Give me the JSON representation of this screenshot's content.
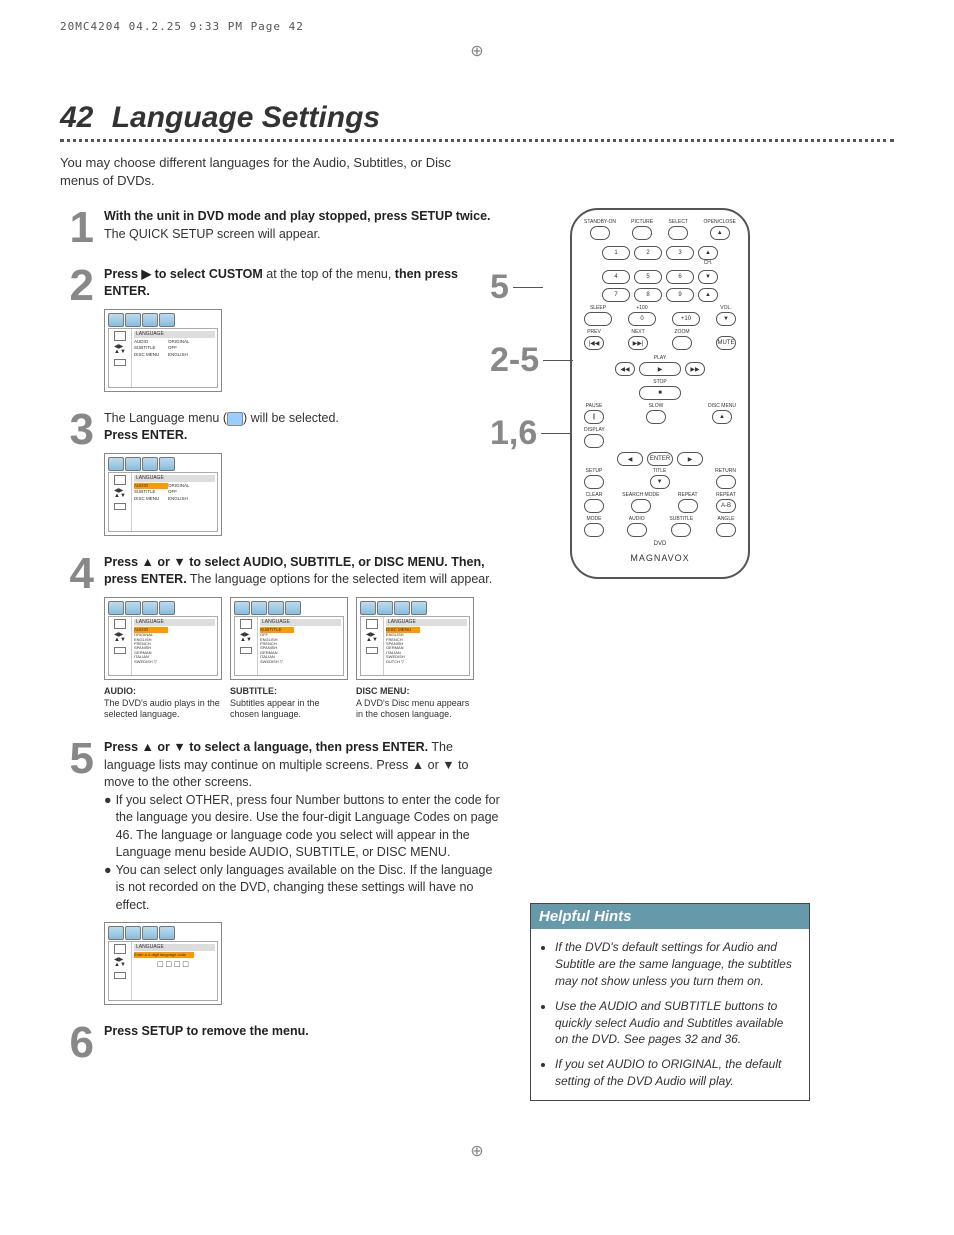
{
  "print_header": "20MC4204  04.2.25  9:33 PM  Page 42",
  "page_number": "42",
  "title": "Language Settings",
  "intro": "You may choose different languages for the Audio, Subtitles, or Disc menus of DVDs.",
  "steps": {
    "s1": {
      "num": "1",
      "bold": "With the unit in DVD mode and play stopped, press SETUP twice.",
      "rest": " The QUICK SETUP screen will appear."
    },
    "s2": {
      "num": "2",
      "bold_a": "Press ",
      "bold_b": " to select CUSTOM",
      "rest": " at the top of the menu, ",
      "bold_c": "then press ENTER."
    },
    "s3": {
      "num": "3",
      "lead": "The Language menu (",
      "lead_end": ") will be selected.",
      "bold": "Press ENTER."
    },
    "s4": {
      "num": "4",
      "bold": "Press ▲ or ▼ to select AUDIO, SUBTITLE, or DISC MENU. Then, press ENTER.",
      "rest": " The language options for the selected item will appear."
    },
    "s5": {
      "num": "5",
      "bold": "Press ▲ or ▼ to select a language, then press ENTER.",
      "rest": " The language lists may continue on multiple screens. Press ▲ or ▼ to move to the other screens.",
      "b1": "If you select OTHER, press four Number buttons to enter the code for the language you desire. Use the four-digit Language Codes on page 46. The language or language code you select will appear in the Language menu beside AUDIO, SUBTITLE, or DISC MENU.",
      "b2": "You can select only languages available on the Disc. If the language is not recorded on the DVD, changing these settings will have no effect."
    },
    "s6": {
      "num": "6",
      "bold": "Press SETUP to remove the menu."
    }
  },
  "menus": {
    "lang_header": "LANGUAGE",
    "rows": {
      "audio": "AUDIO",
      "subtitle": "SUBTITLE",
      "disc_menu": "DISC MENU",
      "original": "ORIGINAL",
      "off": "OFF",
      "english": "ENGLISH"
    },
    "lang_list": [
      "ENGLISH",
      "FRENCH",
      "SPANISH",
      "GERMAN",
      "ITALIAN",
      "SWEDISH"
    ],
    "lang_list_dm": [
      "ENGLISH",
      "FRENCH",
      "SPANISH",
      "GERMAN",
      "ITALIAN",
      "SWEDISH",
      "DUTCH"
    ],
    "other_code": "Enter a 4-digit language code",
    "digits": "□□□□"
  },
  "captions": {
    "audio": {
      "title": "AUDIO:",
      "body": "The DVD's audio plays in the selected language."
    },
    "subtitle": {
      "title": "SUBTITLE:",
      "body": "Subtitles appear in the chosen language."
    },
    "discmenu": {
      "title": "DISC MENU:",
      "body": "A DVD's Disc menu appears in the chosen language."
    }
  },
  "callouts": {
    "c1": "5",
    "c2": "2-5",
    "c3": "1,6"
  },
  "remote_brand": "MAGNAVOX",
  "hints": {
    "title": "Helpful Hints",
    "items": [
      "If the DVD's default settings for Audio and Subtitle are the same language, the subtitles may not show unless you turn them on.",
      "Use the AUDIO and SUBTITLE buttons to quickly select Audio and Subtitles available on the DVD. See pages 32 and 36.",
      "If you set AUDIO to ORIGINAL, the default setting of the DVD Audio will play."
    ]
  },
  "remote": {
    "row1": [
      "STANDBY-ON",
      "PICTURE",
      "SELECT",
      "OPEN/CLOSE"
    ],
    "eject": "▲",
    "nums": [
      "1",
      "2",
      "3",
      "4",
      "5",
      "6",
      "7",
      "8",
      "9",
      "0"
    ],
    "ch": "CH.",
    "sleep": "SLEEP",
    "plus100": "+100",
    "plus10": "+10",
    "vol": "VOL.",
    "prev": "PREV",
    "next": "NEXT",
    "zoom": "ZOOM",
    "prev_sym": "|◀◀",
    "next_sym": "▶▶|",
    "mute": "MUTE",
    "play": "PLAY",
    "play_sym": "▶",
    "rew": "◀◀",
    "ff": "▶▶",
    "stop": "STOP",
    "stop_sym": "■",
    "pause": "PAUSE",
    "pause_sym": "||",
    "slow": "SLOW",
    "disc_menu": "DISC MENU",
    "disc_menu_sym": "▲",
    "display": "DISPLAY",
    "enter": "ENTER",
    "left": "◀",
    "right": "▶",
    "up": "▲",
    "down": "▼",
    "setup": "SETUP",
    "title": "TITLE",
    "return": "RETURN",
    "clear": "CLEAR",
    "search": "SEARCH MODE",
    "repeat": "REPEAT",
    "repeat2": "REPEAT",
    "ab": "A-B",
    "mode": "MODE",
    "audio": "AUDIO",
    "subtitle_b": "SUBTITLE",
    "angle": "ANGLE",
    "dvd": "DVD"
  }
}
